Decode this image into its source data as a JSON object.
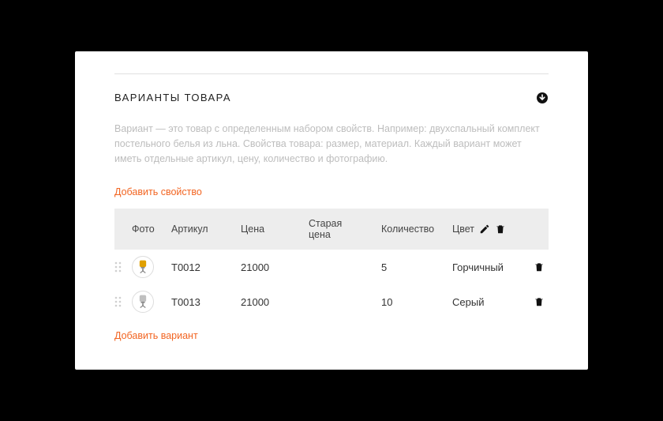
{
  "section": {
    "title": "ВАРИАНТЫ ТОВАРА",
    "description": "Вариант — это товар с определенным набором свойств. Например: двухспальный комплект постельного белья из льна. Свойства товара: размер, материал. Каждый вариант может иметь отдельные артикул, цену, количество и фотографию."
  },
  "actions": {
    "add_property": "Добавить свойство",
    "add_variant": "Добавить вариант"
  },
  "columns": {
    "photo": "Фото",
    "sku": "Артикул",
    "price": "Цена",
    "old_price_line1": "Старая",
    "old_price_line2": "цена",
    "qty": "Количество",
    "color": "Цвет"
  },
  "rows": [
    {
      "sku": "T0012",
      "price": "21000",
      "old_price": "",
      "qty": "5",
      "color": "Горчичный",
      "thumb_tint": "#e0a000"
    },
    {
      "sku": "T0013",
      "price": "21000",
      "old_price": "",
      "qty": "10",
      "color": "Серый",
      "thumb_tint": "#bfbfbf"
    }
  ],
  "colors": {
    "accent": "#f26522"
  }
}
